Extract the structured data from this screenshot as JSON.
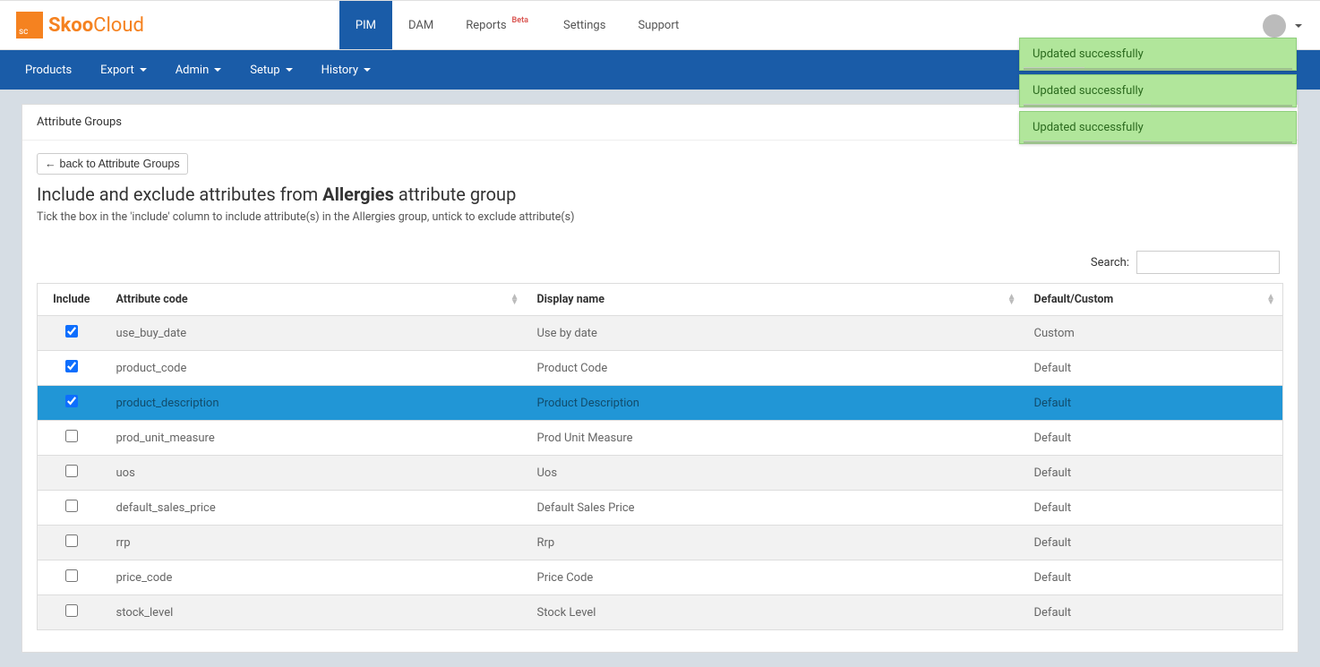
{
  "logo": {
    "sq": "sc",
    "a": "Skoo",
    "b": "Cloud"
  },
  "topnav": [
    {
      "label": "PIM",
      "active": true,
      "badge": null
    },
    {
      "label": "DAM",
      "active": false,
      "badge": null
    },
    {
      "label": "Reports",
      "active": false,
      "badge": "Beta"
    },
    {
      "label": "Settings",
      "active": false,
      "badge": null
    },
    {
      "label": "Support",
      "active": false,
      "badge": null
    }
  ],
  "subnav": [
    {
      "label": "Products",
      "caret": false
    },
    {
      "label": "Export",
      "caret": true
    },
    {
      "label": "Admin",
      "caret": true
    },
    {
      "label": "Setup",
      "caret": true
    },
    {
      "label": "History",
      "caret": true
    }
  ],
  "panel_header": "Attribute Groups",
  "back_btn": "back to Attribute Groups",
  "title_pre": "Include and exclude attributes from ",
  "title_bold": "Allergies",
  "title_post": " attribute group",
  "subtitle": "Tick the box in the 'include' column to include attribute(s) in the Allergies group, untick to exclude attribute(s)",
  "search_label": "Search:",
  "search_value": "",
  "columns": {
    "include": "Include",
    "code": "Attribute code",
    "display": "Display name",
    "type": "Default/Custom"
  },
  "rows": [
    {
      "checked": true,
      "selected": false,
      "code": "use_buy_date",
      "display": "Use by date",
      "type": "Custom"
    },
    {
      "checked": true,
      "selected": false,
      "code": "product_code",
      "display": "Product Code",
      "type": "Default"
    },
    {
      "checked": true,
      "selected": true,
      "code": "product_description",
      "display": "Product Description",
      "type": "Default"
    },
    {
      "checked": false,
      "selected": false,
      "code": "prod_unit_measure",
      "display": "Prod Unit Measure",
      "type": "Default"
    },
    {
      "checked": false,
      "selected": false,
      "code": "uos",
      "display": "Uos",
      "type": "Default"
    },
    {
      "checked": false,
      "selected": false,
      "code": "default_sales_price",
      "display": "Default Sales Price",
      "type": "Default"
    },
    {
      "checked": false,
      "selected": false,
      "code": "rrp",
      "display": "Rrp",
      "type": "Default"
    },
    {
      "checked": false,
      "selected": false,
      "code": "price_code",
      "display": "Price Code",
      "type": "Default"
    },
    {
      "checked": false,
      "selected": false,
      "code": "stock_level",
      "display": "Stock Level",
      "type": "Default"
    }
  ],
  "toasts": [
    {
      "msg": "Updated successfully",
      "progress": 22
    },
    {
      "msg": "Updated successfully",
      "progress": 46
    },
    {
      "msg": "Updated successfully",
      "progress": 46
    }
  ]
}
